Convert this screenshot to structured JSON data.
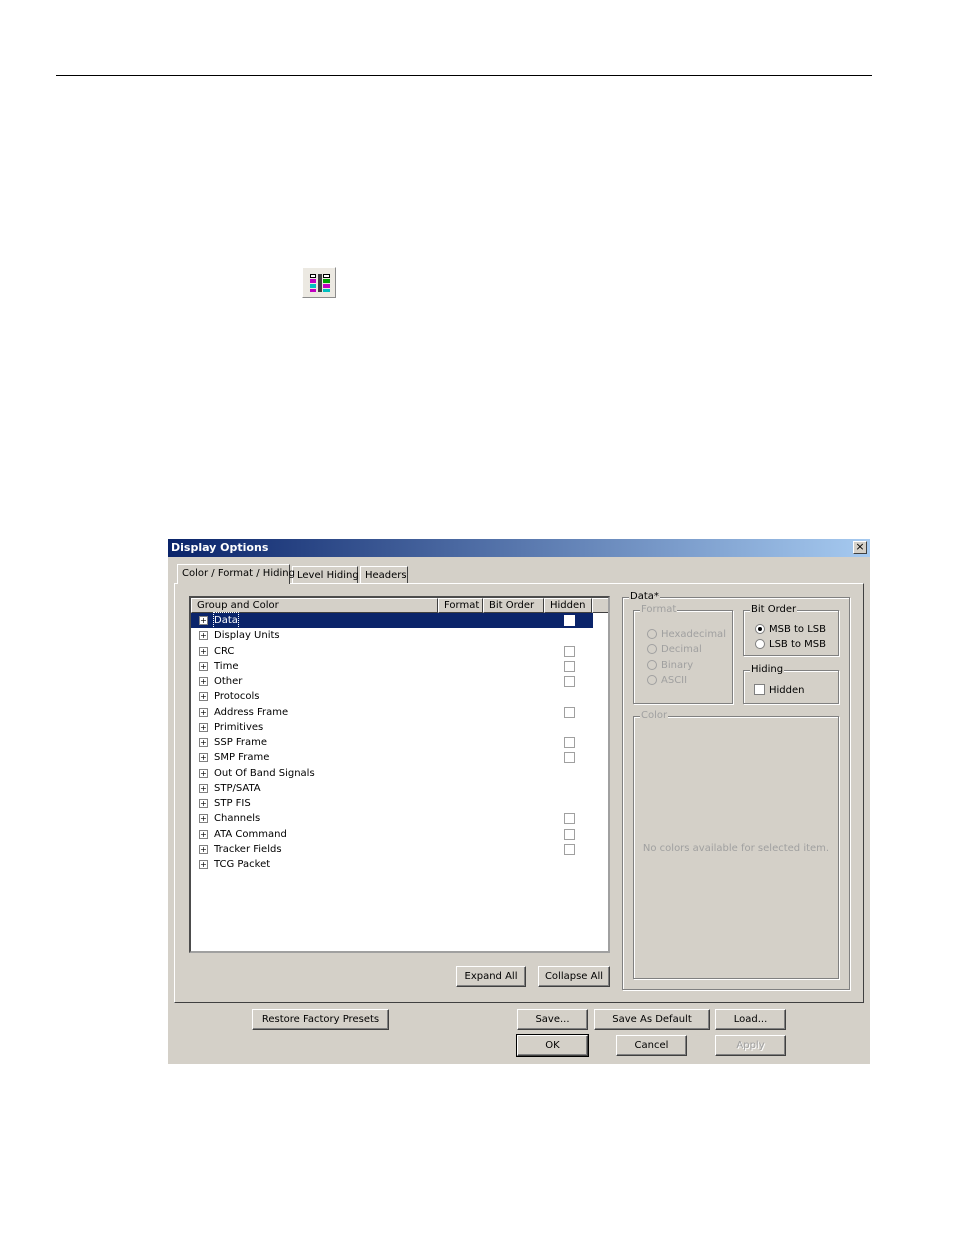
{
  "toolbar_icon": {
    "name": "display-options-icon"
  },
  "dialog": {
    "title": "Display Options",
    "close_glyph": "×",
    "tabs": [
      {
        "label": "Color / Format / Hiding",
        "active": true
      },
      {
        "label": "Level Hiding",
        "active": false
      },
      {
        "label": "Headers",
        "active": false
      }
    ],
    "tree": {
      "columns": [
        "Group and Color",
        "Format",
        "Bit Order",
        "Hidden"
      ],
      "rows": [
        {
          "label": "Data",
          "selected": true,
          "hidden_checkbox": true
        },
        {
          "label": "Display Units",
          "selected": false,
          "hidden_checkbox": false
        },
        {
          "label": "CRC",
          "selected": false,
          "hidden_checkbox": true
        },
        {
          "label": "Time",
          "selected": false,
          "hidden_checkbox": true
        },
        {
          "label": "Other",
          "selected": false,
          "hidden_checkbox": true
        },
        {
          "label": "Protocols",
          "selected": false,
          "hidden_checkbox": false
        },
        {
          "label": "Address Frame",
          "selected": false,
          "hidden_checkbox": true
        },
        {
          "label": "Primitives",
          "selected": false,
          "hidden_checkbox": false
        },
        {
          "label": "SSP Frame",
          "selected": false,
          "hidden_checkbox": true
        },
        {
          "label": "SMP Frame",
          "selected": false,
          "hidden_checkbox": true
        },
        {
          "label": "Out Of Band Signals",
          "selected": false,
          "hidden_checkbox": false
        },
        {
          "label": "STP/SATA",
          "selected": false,
          "hidden_checkbox": false
        },
        {
          "label": "STP FIS",
          "selected": false,
          "hidden_checkbox": false
        },
        {
          "label": "Channels",
          "selected": false,
          "hidden_checkbox": true
        },
        {
          "label": "ATA Command",
          "selected": false,
          "hidden_checkbox": true
        },
        {
          "label": "Tracker Fields",
          "selected": false,
          "hidden_checkbox": true
        },
        {
          "label": "TCG Packet",
          "selected": false,
          "hidden_checkbox": false
        }
      ]
    },
    "expand_all": "Expand All",
    "collapse_all": "Collapse All",
    "details": {
      "group_title": "Data*",
      "format": {
        "title": "Format",
        "options": [
          "Hexadecimal",
          "Decimal",
          "Binary",
          "ASCII"
        ],
        "disabled": true
      },
      "bit_order": {
        "title": "Bit Order",
        "options": [
          "MSB to LSB",
          "LSB to MSB"
        ],
        "selected": "MSB to LSB"
      },
      "hiding": {
        "title": "Hiding",
        "checkbox_label": "Hidden",
        "checked": false
      },
      "color": {
        "title": "Color",
        "empty_message": "No colors available for selected item."
      }
    },
    "buttons": {
      "restore": "Restore Factory Presets",
      "save": "Save...",
      "save_default": "Save As Default",
      "load": "Load...",
      "ok": "OK",
      "cancel": "Cancel",
      "apply": "Apply"
    }
  },
  "colors": {
    "title_start": "#0a246a",
    "title_end": "#a6caf0",
    "face": "#d4d0c8",
    "selection": "#0a246a"
  }
}
